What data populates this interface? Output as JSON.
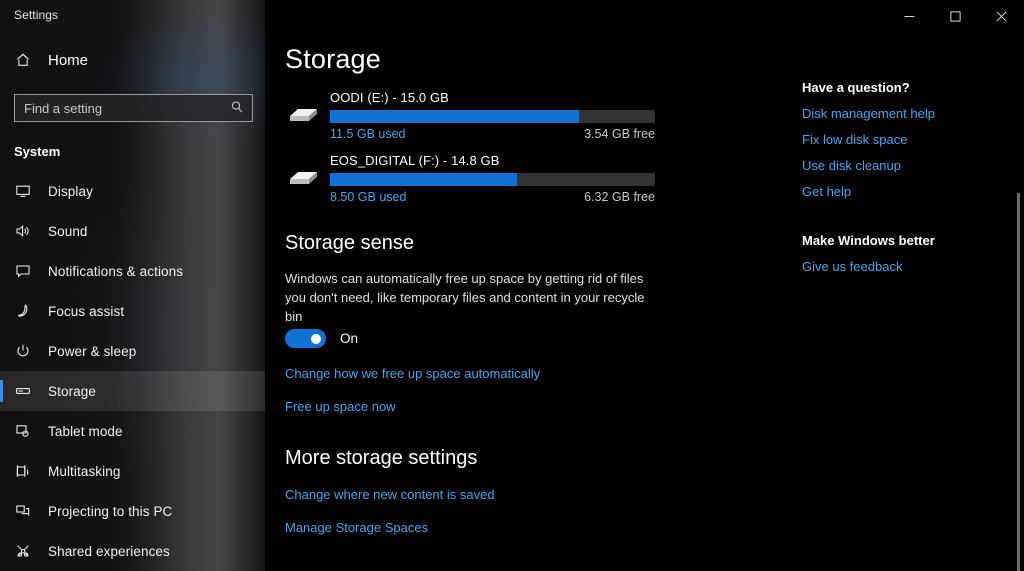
{
  "window": {
    "title": "Settings",
    "controls": [
      {
        "name": "minimize",
        "label": "Minimize"
      },
      {
        "name": "maximize",
        "label": "Maximize"
      },
      {
        "name": "close",
        "label": "Close"
      }
    ]
  },
  "sidebar": {
    "home_label": "Home",
    "home_icon": "home-icon",
    "search": {
      "placeholder": "Find a setting",
      "value": "",
      "icon": "search-icon"
    },
    "group_title": "System",
    "items": [
      {
        "label": "Display",
        "icon": "monitor-icon",
        "selected": false
      },
      {
        "label": "Sound",
        "icon": "speaker-icon",
        "selected": false
      },
      {
        "label": "Notifications & actions",
        "icon": "notification-icon",
        "selected": false
      },
      {
        "label": "Focus assist",
        "icon": "moon-icon",
        "selected": false
      },
      {
        "label": "Power & sleep",
        "icon": "power-icon",
        "selected": false
      },
      {
        "label": "Storage",
        "icon": "storage-icon",
        "selected": true
      },
      {
        "label": "Tablet mode",
        "icon": "tablet-icon",
        "selected": false
      },
      {
        "label": "Multitasking",
        "icon": "multitasking-icon",
        "selected": false
      },
      {
        "label": "Projecting to this PC",
        "icon": "projecting-icon",
        "selected": false
      },
      {
        "label": "Shared experiences",
        "icon": "shared-icon",
        "selected": false
      }
    ]
  },
  "main": {
    "page_title": "Storage",
    "drives": [
      {
        "name": "OODI (E:) - 15.0 GB",
        "used_label": "11.5 GB used",
        "free_label": "3.54 GB free",
        "used_percent": 76.7,
        "icon": "drive-icon"
      },
      {
        "name": "EOS_DIGITAL (F:) - 14.8 GB",
        "used_label": "8.50 GB used",
        "free_label": "6.32 GB free",
        "used_percent": 57.4,
        "icon": "drive-icon"
      }
    ],
    "storage_sense": {
      "title": "Storage sense",
      "description": "Windows can automatically free up space by getting rid of files you don't need, like temporary files and content in your recycle bin",
      "toggle_state": "On",
      "toggle_on": true,
      "link_change_auto": "Change how we free up space automatically",
      "link_free_up": "Free up space now"
    },
    "more_settings": {
      "title": "More storage settings",
      "link_change_saved": "Change where new content is saved",
      "link_manage_spaces": "Manage Storage Spaces"
    }
  },
  "rail": {
    "question_heading": "Have a question?",
    "question_links": [
      "Disk management help",
      "Fix low disk space",
      "Use disk cleanup",
      "Get help"
    ],
    "feedback_heading": "Make Windows better",
    "feedback_links": [
      "Give us feedback"
    ]
  },
  "colors": {
    "accent": "#0f72d4",
    "link": "#4da3e8",
    "selection_bar": "#3b8eea",
    "bar_track": "#333333",
    "background": "#000000"
  }
}
